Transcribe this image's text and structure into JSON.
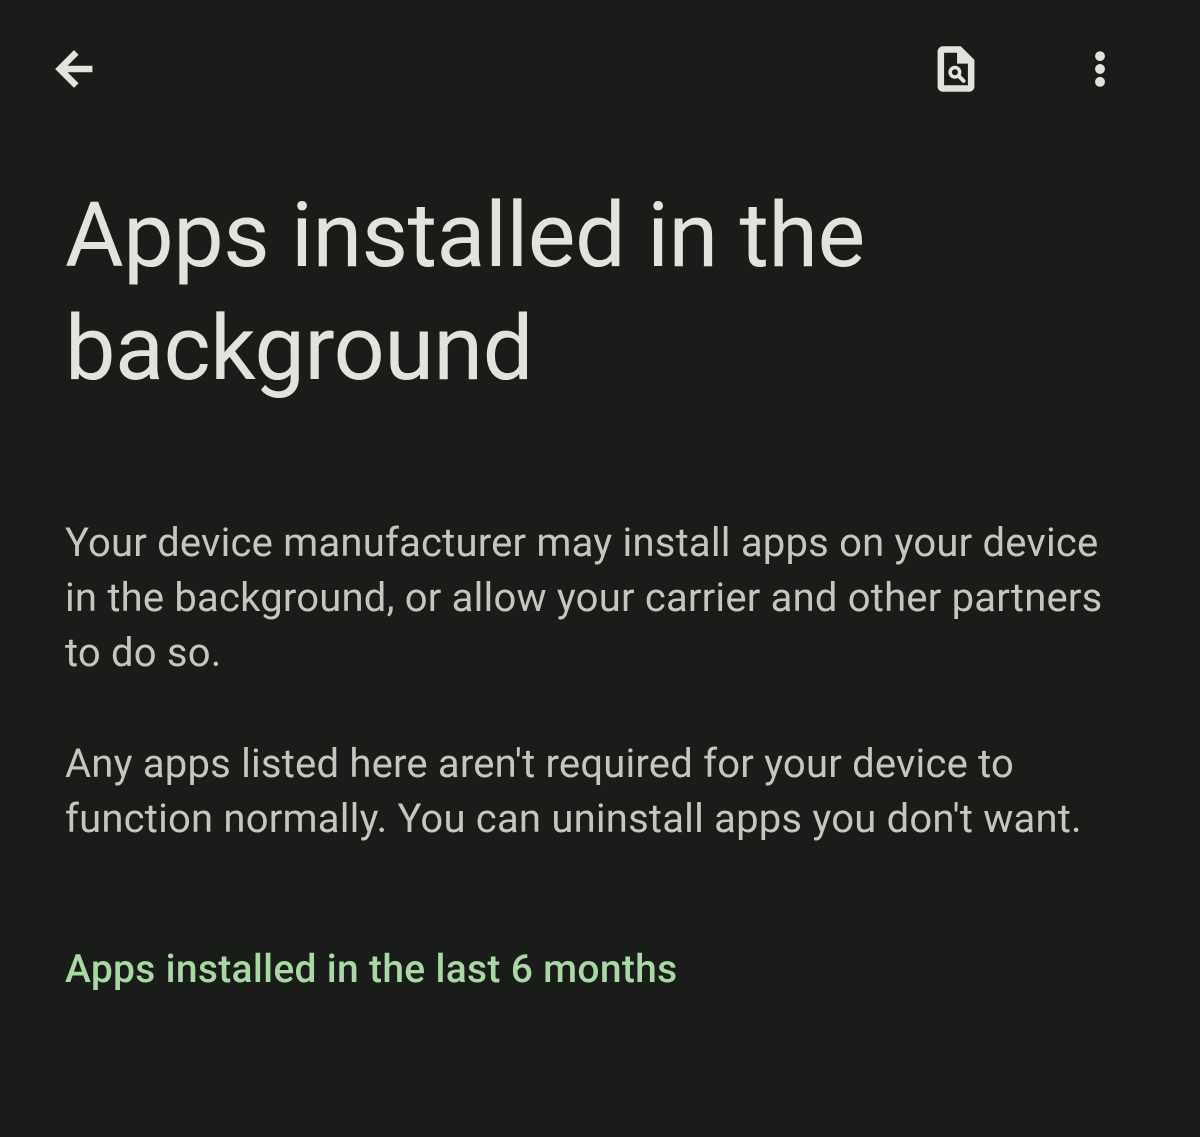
{
  "header": {
    "back_icon": "arrow-back",
    "search_icon": "search-in-page",
    "overflow_icon": "more-vert"
  },
  "main": {
    "title": "Apps installed in the background",
    "description_1": "Your device manufacturer may install apps on your device in the background, or allow your carrier and other partners to do so.",
    "description_2": "Any apps listed here aren't required for your device to function normally. You can uninstall apps you don't want.",
    "section_header": "Apps installed in the last 6 months"
  },
  "colors": {
    "background": "#1a1c19",
    "text_primary": "#e2e3dd",
    "text_secondary": "#c4c7c0",
    "accent": "#a9d8a5"
  }
}
